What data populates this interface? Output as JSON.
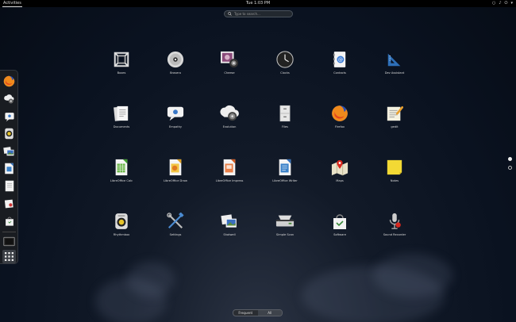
{
  "topbar": {
    "activities": "Activities",
    "clock": "Tue 1:03 PM"
  },
  "search": {
    "placeholder": "Type to search..."
  },
  "dash": {
    "items": [
      {
        "name": "firefox"
      },
      {
        "name": "settings"
      },
      {
        "name": "empathy"
      },
      {
        "name": "rhythmbox"
      },
      {
        "name": "shotwell"
      },
      {
        "name": "libreoffice-writer"
      },
      {
        "name": "documents"
      },
      {
        "name": "evolution"
      },
      {
        "name": "software"
      },
      {
        "name": "terminal"
      },
      {
        "name": "show-applications"
      }
    ]
  },
  "apps": [
    {
      "label": "Boxes",
      "icon": "boxes-icon"
    },
    {
      "label": "Brasero",
      "icon": "disc-icon"
    },
    {
      "label": "Cheese",
      "icon": "webcam-icon"
    },
    {
      "label": "Clocks",
      "icon": "clock-icon"
    },
    {
      "label": "Contacts",
      "icon": "contacts-icon"
    },
    {
      "label": "Dev Assistant",
      "icon": "devassistant-icon"
    },
    {
      "label": "Documents",
      "icon": "documents-icon"
    },
    {
      "label": "Empathy",
      "icon": "empathy-icon"
    },
    {
      "label": "Evolution",
      "icon": "evolution-icon"
    },
    {
      "label": "Files",
      "icon": "files-icon"
    },
    {
      "label": "Firefox",
      "icon": "firefox-icon"
    },
    {
      "label": "gedit",
      "icon": "gedit-icon"
    },
    {
      "label": "LibreOffice Calc",
      "icon": "calc-icon"
    },
    {
      "label": "LibreOffice Draw",
      "icon": "draw-icon"
    },
    {
      "label": "LibreOffice Impress",
      "icon": "impress-icon"
    },
    {
      "label": "LibreOffice Writer",
      "icon": "writer-icon"
    },
    {
      "label": "Maps",
      "icon": "maps-icon"
    },
    {
      "label": "Notes",
      "icon": "notes-icon"
    },
    {
      "label": "Rhythmbox",
      "icon": "rhythmbox-icon"
    },
    {
      "label": "Settings",
      "icon": "settings-icon"
    },
    {
      "label": "Shotwell",
      "icon": "shotwell-icon"
    },
    {
      "label": "Simple Scan",
      "icon": "scanner-icon"
    },
    {
      "label": "Software",
      "icon": "software-icon"
    },
    {
      "label": "Sound Recorder",
      "icon": "microphone-icon"
    }
  ],
  "switcher": {
    "frequent": "Frequent",
    "all": "All"
  }
}
